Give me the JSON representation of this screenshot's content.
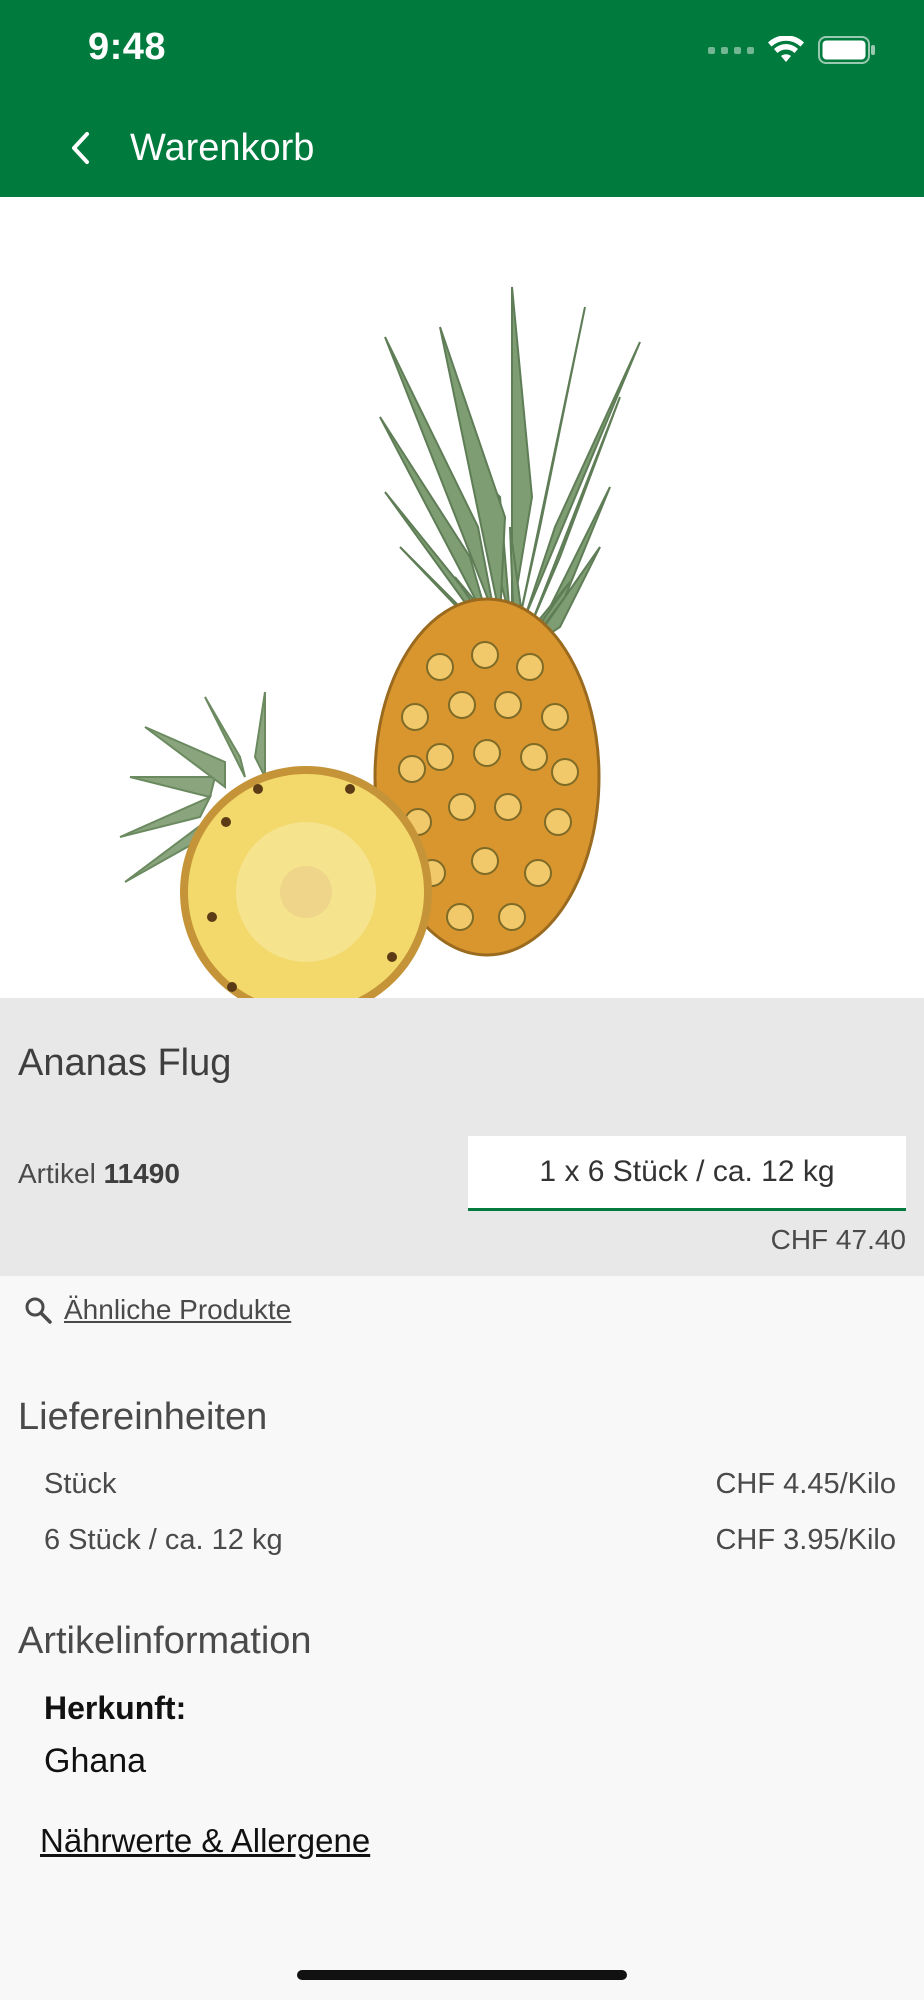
{
  "status_bar": {
    "time": "9:48",
    "icons": [
      "signal-icon",
      "wifi-icon",
      "battery-icon"
    ]
  },
  "nav": {
    "back_icon": "chevron-left-icon",
    "title": "Warenkorb"
  },
  "product": {
    "image_alt": "pineapple-image",
    "name": "Ananas Flug",
    "article_label": "Artikel",
    "article_number": "11490",
    "selected_unit": "1 x 6 Stück / ca. 12 kg",
    "price": "CHF 47.40"
  },
  "similar": {
    "icon": "search-icon",
    "label": "Ähnliche Produkte"
  },
  "delivery_units": {
    "title": "Liefereinheiten",
    "rows": [
      {
        "unit": "Stück",
        "price": "CHF 4.45/Kilo"
      },
      {
        "unit": "6 Stück / ca. 12 kg",
        "price": "CHF 3.95/Kilo"
      }
    ]
  },
  "article_info": {
    "title": "Artikelinformation",
    "origin_label": "Herkunft:",
    "origin_value": "Ghana",
    "nutrition_link": "Nährwerte & Allergene"
  },
  "colors": {
    "brand_green": "#007a3d",
    "info_bg": "#e8e8e8",
    "page_bg": "#f8f8f8"
  }
}
